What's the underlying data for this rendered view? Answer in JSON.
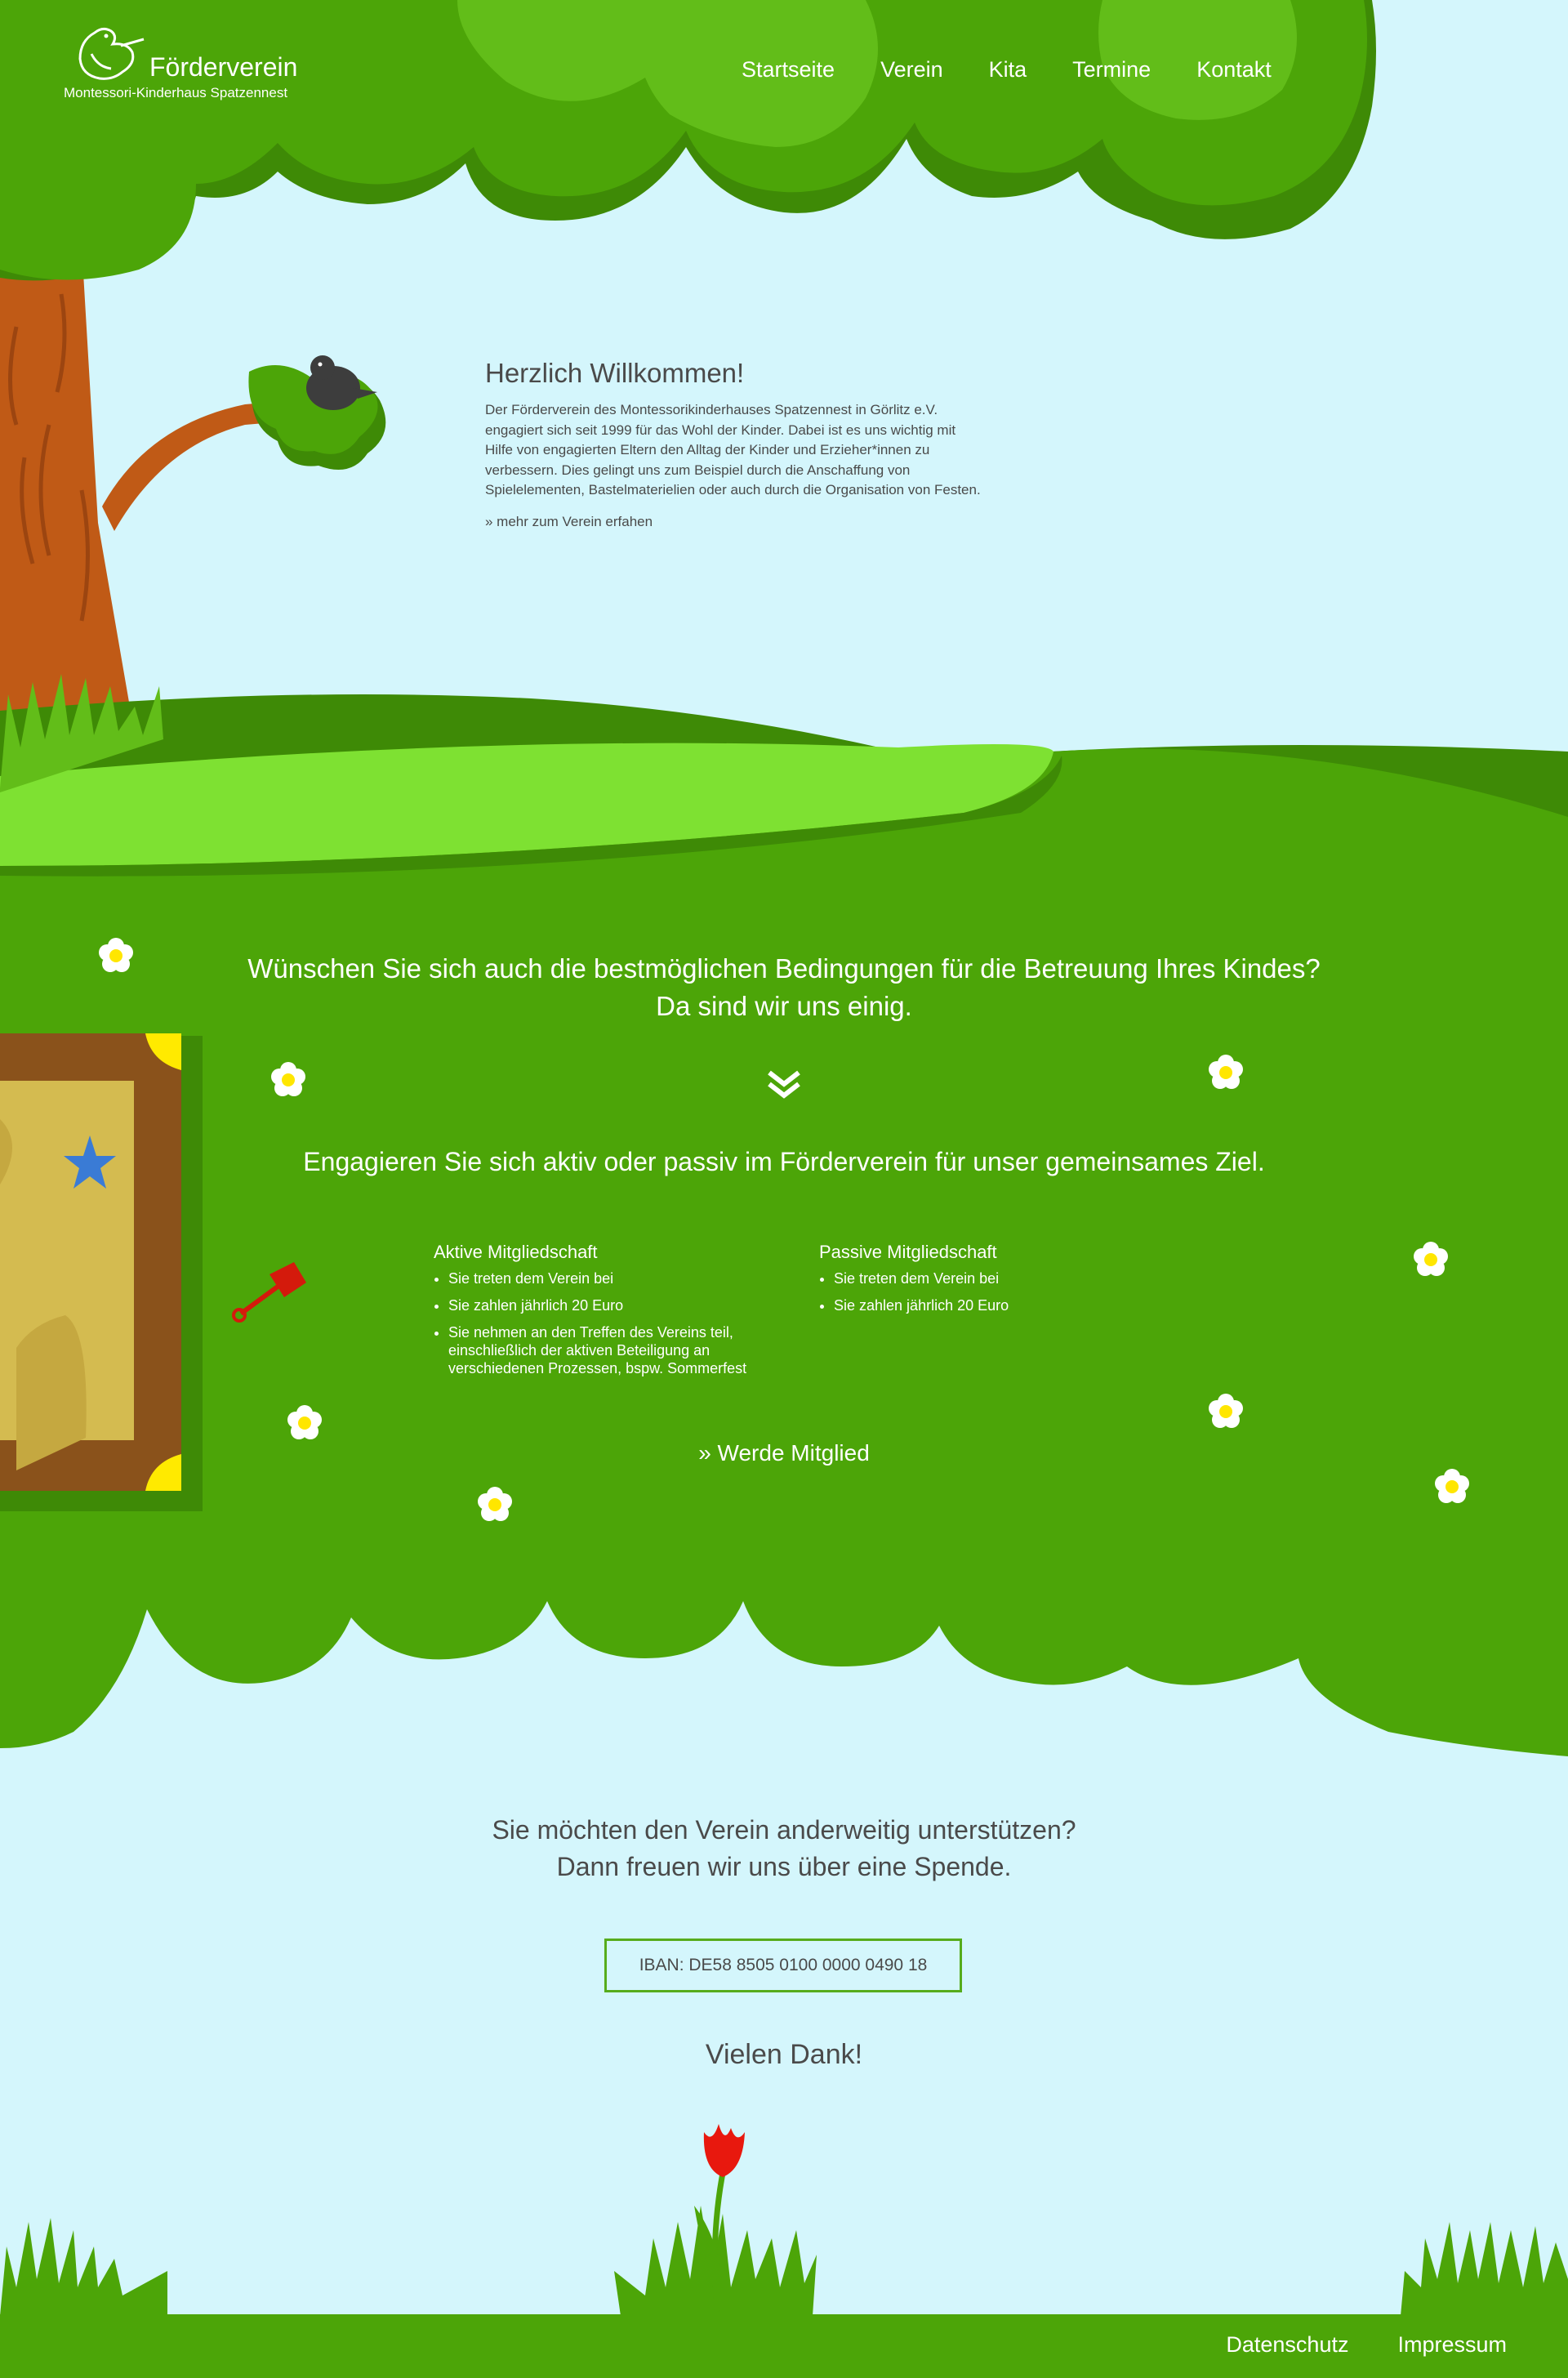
{
  "brand": {
    "title": "Förderverein",
    "subtitle": "Montessori-Kinderhaus Spatzennest"
  },
  "nav": [
    "Startseite",
    "Verein",
    "Kita",
    "Termine",
    "Kontakt"
  ],
  "welcome": {
    "heading": "Herzlich Willkommen!",
    "lines": [
      "Der Förderverein des Montessorikinderhauses Spatzennest in Görlitz e.V.",
      "engagiert sich seit 1999 für das Wohl der Kinder. Dabei ist es uns wichtig mit",
      "Hilfe von engagierten Eltern den Alltag der Kinder und Erzieher*innen zu",
      "verbessern. Dies gelingt uns zum Beispiel durch die Anschaffung von",
      "Spielelementen, Bastelmaterielien oder auch durch die Organisation von Festen."
    ],
    "link": "» mehr zum Verein erfahen"
  },
  "membership": {
    "question_line1": "Wünschen Sie sich auch die bestmöglichen Bedingungen für die Betreuung Ihres Kindes?",
    "question_line2": "Da sind wir uns einig.",
    "engage": "Engagieren Sie sich aktiv oder passiv im Förderverein für unser gemeinsames Ziel.",
    "active": {
      "title": "Aktive Mitgliedschaft",
      "items": [
        "Sie treten dem Verein bei",
        "Sie zahlen jährlich 20 Euro",
        "Sie nehmen an den Treffen des Vereins teil, einschließlich der aktiven Beteiligung an verschiedenen Prozessen, bspw. Sommerfest"
      ]
    },
    "passive": {
      "title": "Passive Mitgliedschaft",
      "items": [
        "Sie treten dem Verein bei",
        "Sie zahlen jährlich 20 Euro"
      ]
    },
    "join": "» Werde Mitglied"
  },
  "donation": {
    "line1": "Sie möchten den Verein anderweitig unterstützen?",
    "line2": "Dann freuen wir uns über eine Spende.",
    "iban": "IBAN: DE58 8505 0100 0000 0490 18",
    "thanks": "Vielen Dank!"
  },
  "footer": {
    "privacy": "Datenschutz",
    "imprint": "Impressum"
  },
  "colors": {
    "sky": "#d4f6fc",
    "leaf": "#4ca508",
    "leaf_dark": "#3e8a06",
    "leaf_light": "#62bd19",
    "trunk": "#c05a16",
    "text": "#4a4a4a"
  }
}
